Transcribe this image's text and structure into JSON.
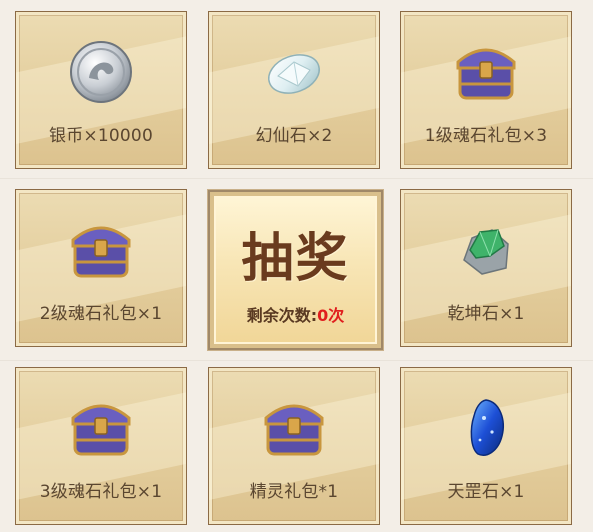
{
  "prizes": [
    {
      "label": "银币×10000",
      "icon": "silver-coin-icon"
    },
    {
      "label": "幻仙石×2",
      "icon": "crystal-gem-icon"
    },
    {
      "label": "1级魂石礼包×3",
      "icon": "treasure-chest-icon"
    },
    {
      "label": "2级魂石礼包×1",
      "icon": "treasure-chest-icon"
    },
    {
      "label": "乾坤石×1",
      "icon": "green-ore-icon"
    },
    {
      "label": "3级魂石礼包×1",
      "icon": "treasure-chest-icon"
    },
    {
      "label": "精灵礼包*1",
      "icon": "treasure-chest-icon"
    },
    {
      "label": "天罡石×1",
      "icon": "blue-stone-icon"
    }
  ],
  "draw": {
    "title": "抽奖",
    "remaining_label": "剩余次数:",
    "remaining_value": "0次"
  },
  "colors": {
    "label_text": "#5a4630",
    "remaining_value": "#e01e1e",
    "title_text": "#6a3b1e"
  }
}
